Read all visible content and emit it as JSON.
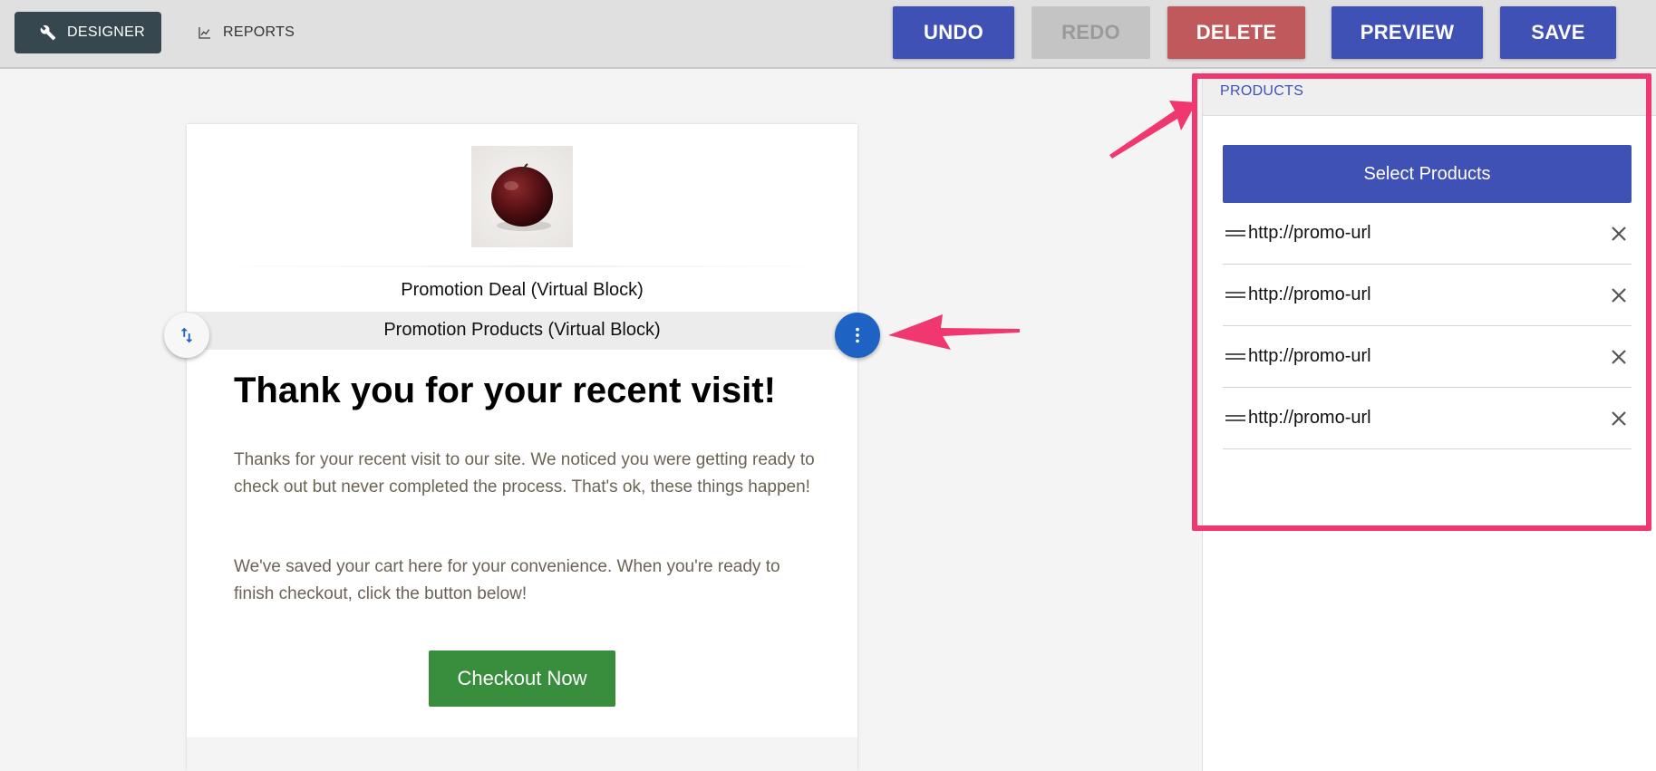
{
  "toolbar": {
    "designer_label": "DESIGNER",
    "reports_label": "REPORTS",
    "undo_label": "UNDO",
    "redo_label": "REDO",
    "delete_label": "DELETE",
    "preview_label": "PREVIEW",
    "save_label": "SAVE"
  },
  "email": {
    "deal_block_label": "Promotion Deal (Virtual Block)",
    "products_block_label": "Promotion Products (Virtual Block)",
    "headline": "Thank you for your recent visit!",
    "paragraph1": "Thanks for your recent visit to our site. We noticed you were getting ready to check out but never completed the process. That's ok, these things happen!",
    "paragraph2": "We've saved your cart here for your convenience. When you're ready to finish checkout, click the button below!",
    "checkout_label": "Checkout Now"
  },
  "panel": {
    "title": "PRODUCTS",
    "select_label": "Select Products",
    "products": [
      {
        "url": "http://promo-url"
      },
      {
        "url": "http://promo-url"
      },
      {
        "url": "http://promo-url"
      },
      {
        "url": "http://promo-url"
      }
    ]
  },
  "colors": {
    "primary": "#3f51b5",
    "delete": "#c0595b",
    "checkout": "#388e3c",
    "annotation": "#f0376f",
    "fab": "#1e63c4"
  },
  "icons": {
    "designer": "wrench-icon",
    "reports": "chart-icon",
    "move": "swap-vertical-icon",
    "more": "more-vertical-icon",
    "drag": "drag-handle-icon",
    "remove": "close-icon"
  }
}
